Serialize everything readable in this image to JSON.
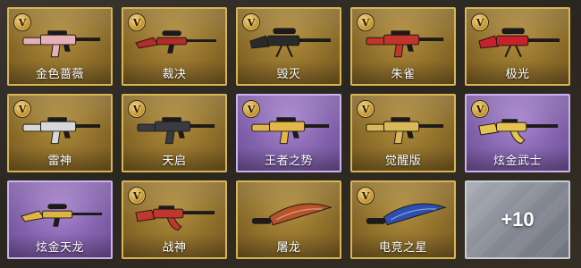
{
  "badge_letter": "V",
  "colors": {
    "gold_card": "#8f6f2a",
    "purple_card": "#8463ad",
    "silver_card": "#868a94",
    "frame_gold": "#d9b552"
  },
  "items": [
    {
      "name": "金色蔷薇",
      "rarity": "gold",
      "badge": true,
      "icon": "assault-rifle-icon",
      "tint": "#e6b0b8"
    },
    {
      "name": "裁决",
      "rarity": "gold",
      "badge": true,
      "icon": "sniper-rifle-icon",
      "tint": "#b52a2a"
    },
    {
      "name": "毁灭",
      "rarity": "gold",
      "badge": true,
      "icon": "heavy-sniper-icon",
      "tint": "#2a2a2a"
    },
    {
      "name": "朱雀",
      "rarity": "gold",
      "badge": true,
      "icon": "assault-rifle-icon",
      "tint": "#c2352b"
    },
    {
      "name": "极光",
      "rarity": "gold",
      "badge": true,
      "icon": "heavy-sniper-icon",
      "tint": "#c9202a"
    },
    {
      "name": "雷神",
      "rarity": "gold",
      "badge": true,
      "icon": "assault-rifle-icon",
      "tint": "#d8d8d8"
    },
    {
      "name": "天启",
      "rarity": "gold",
      "badge": true,
      "icon": "assault-rifle-icon",
      "tint": "#3a3a42"
    },
    {
      "name": "王者之势",
      "rarity": "purple",
      "badge": true,
      "icon": "assault-rifle-icon",
      "tint": "#e2b64a"
    },
    {
      "name": "觉醒版",
      "rarity": "gold",
      "badge": true,
      "icon": "assault-rifle-icon",
      "tint": "#d9b85a"
    },
    {
      "name": "炫金武士",
      "rarity": "purple",
      "badge": true,
      "icon": "ak-rifle-icon",
      "tint": "#e6c24e"
    },
    {
      "name": "炫金天龙",
      "rarity": "purple",
      "badge": false,
      "icon": "sniper-rifle-icon",
      "tint": "#e0b443"
    },
    {
      "name": "战神",
      "rarity": "gold",
      "badge": true,
      "icon": "ak-rifle-icon",
      "tint": "#c0382b"
    },
    {
      "name": "屠龙",
      "rarity": "gold",
      "badge": false,
      "icon": "machete-icon",
      "tint": "#b8522a"
    },
    {
      "name": "电竞之星",
      "rarity": "gold",
      "badge": true,
      "icon": "machete-icon",
      "tint": "#2d4fb0"
    }
  ],
  "more_card": {
    "label": "+10"
  }
}
